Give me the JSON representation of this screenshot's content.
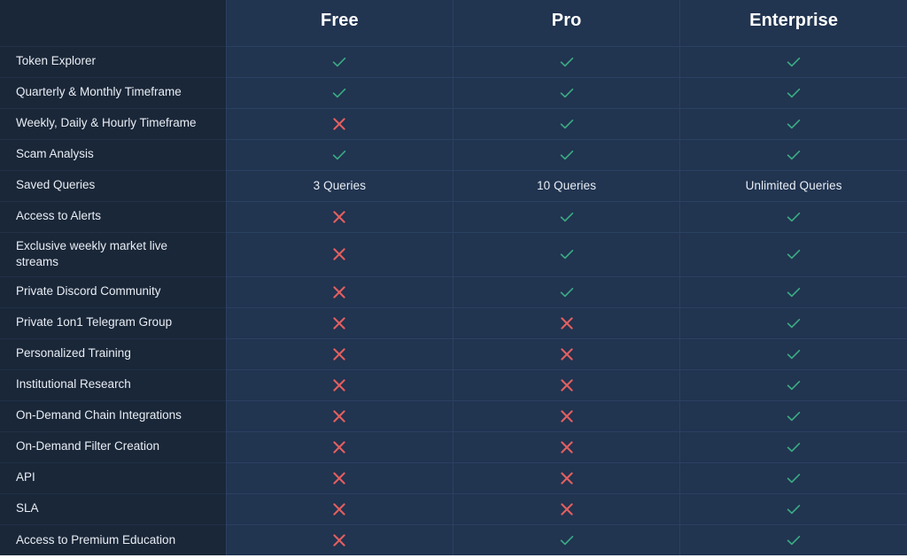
{
  "table": {
    "feature_column_header": "",
    "plans": [
      "Free",
      "Pro",
      "Enterprise"
    ],
    "colors": {
      "page_background": "#ffffff",
      "feature_column_background": "#1a2738",
      "plan_column_background": "#213450",
      "row_divider": "#2b4163",
      "header_text": "#ffffff",
      "feature_text": "#e8edf4",
      "check_mark": "#3aa882",
      "cross_mark": "#e35f5f"
    },
    "icons": {
      "check": "check-icon",
      "cross": "cross-icon"
    },
    "rows": [
      {
        "feature": "Token Explorer",
        "cells": [
          "check",
          "check",
          "check"
        ]
      },
      {
        "feature": "Quarterly & Monthly Timeframe",
        "cells": [
          "check",
          "check",
          "check"
        ]
      },
      {
        "feature": "Weekly, Daily & Hourly Timeframe",
        "cells": [
          "cross",
          "check",
          "check"
        ]
      },
      {
        "feature": "Scam Analysis",
        "cells": [
          "check",
          "check",
          "check"
        ]
      },
      {
        "feature": "Saved Queries",
        "cells": [
          "3 Queries",
          "10 Queries",
          "Unlimited Queries"
        ]
      },
      {
        "feature": "Access to Alerts",
        "cells": [
          "cross",
          "check",
          "check"
        ]
      },
      {
        "feature": "Exclusive weekly market live streams",
        "cells": [
          "cross",
          "check",
          "check"
        ],
        "tall": true
      },
      {
        "feature": "Private Discord Community",
        "cells": [
          "cross",
          "check",
          "check"
        ]
      },
      {
        "feature": "Private 1on1 Telegram Group",
        "cells": [
          "cross",
          "cross",
          "check"
        ]
      },
      {
        "feature": "Personalized Training",
        "cells": [
          "cross",
          "cross",
          "check"
        ]
      },
      {
        "feature": "Institutional Research",
        "cells": [
          "cross",
          "cross",
          "check"
        ]
      },
      {
        "feature": "On-Demand Chain Integrations",
        "cells": [
          "cross",
          "cross",
          "check"
        ]
      },
      {
        "feature": "On-Demand Filter Creation",
        "cells": [
          "cross",
          "cross",
          "check"
        ]
      },
      {
        "feature": "API",
        "cells": [
          "cross",
          "cross",
          "check"
        ]
      },
      {
        "feature": "SLA",
        "cells": [
          "cross",
          "cross",
          "check"
        ]
      },
      {
        "feature": "Access to Premium Education",
        "cells": [
          "cross",
          "check",
          "check"
        ]
      }
    ]
  }
}
